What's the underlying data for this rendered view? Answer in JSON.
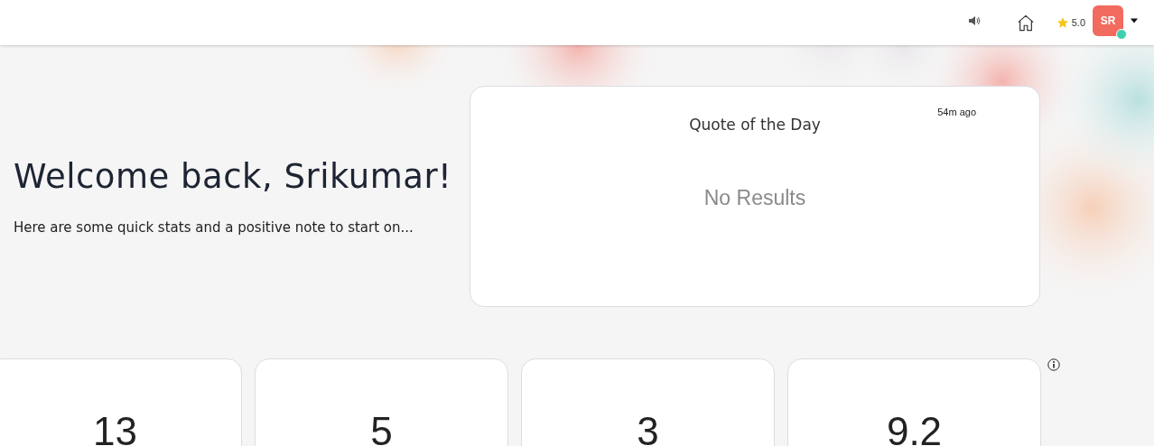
{
  "header": {
    "rating": "5.0",
    "avatar": {
      "initials": "SR",
      "online": true
    }
  },
  "welcome": {
    "title": "Welcome back, Srikumar!",
    "subtitle": "Here are some quick stats and a positive note to start on..."
  },
  "quote_card": {
    "title": "Quote of the Day",
    "time": "54m ago",
    "message": "No Results"
  },
  "stats": [
    {
      "value": "13"
    },
    {
      "value": "5"
    },
    {
      "value": "3"
    },
    {
      "value": "9.2"
    }
  ]
}
